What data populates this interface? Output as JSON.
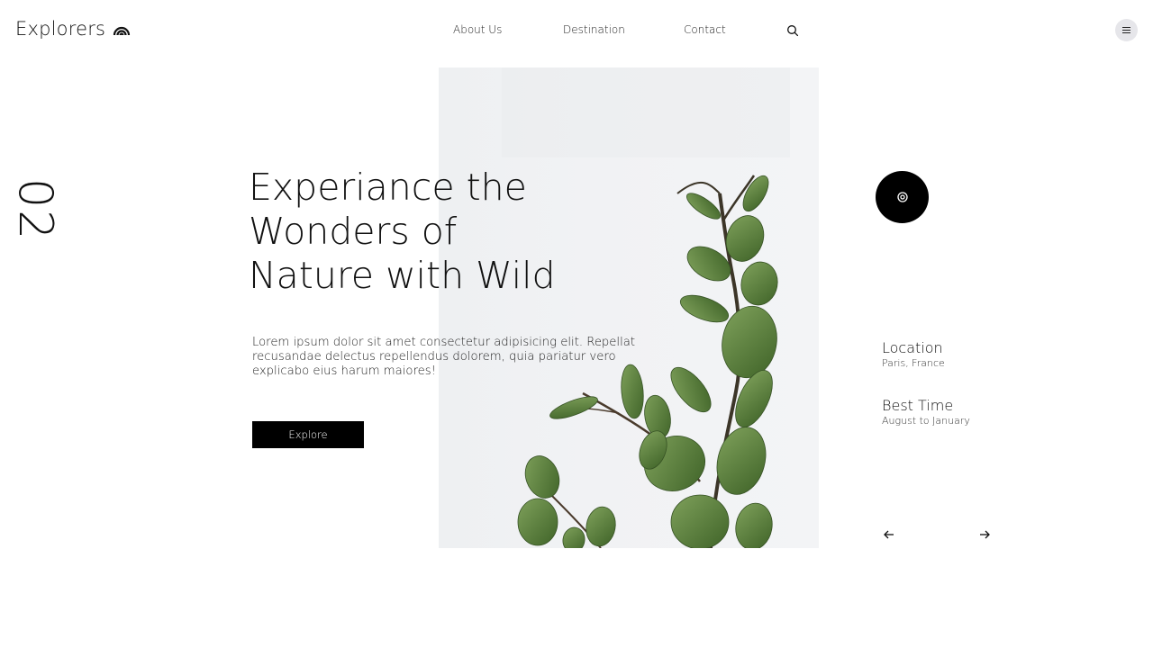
{
  "brand": {
    "name": "Explorers",
    "icon": "rainbow-arc-icon"
  },
  "nav": {
    "items": [
      {
        "label": "About Us"
      },
      {
        "label": "Destination"
      },
      {
        "label": "Contact"
      }
    ],
    "search_icon": "search-icon",
    "menu_icon": "hamburger-menu-icon"
  },
  "slide": {
    "number": "02"
  },
  "hero": {
    "headline_lines": [
      "Experiance the",
      "Wonders of",
      "Nature with Wild"
    ],
    "description": "Lorem ipsum dolor sit amet consectetur adipisicing elit. Repellat recusandae delectus repellendus dolorem, quia pariatur vero explicabo eius harum maiores!",
    "cta_label": "Explore",
    "image": "eucalyptus-branch-photo"
  },
  "view_button": {
    "icon": "eye-icon"
  },
  "details": {
    "location": {
      "label": "Location",
      "value": "Paris, France"
    },
    "best_time": {
      "label": "Best Time",
      "value": "August to January"
    }
  },
  "carousel": {
    "prev_icon": "arrow-left-icon",
    "next_icon": "arrow-right-icon"
  },
  "colors": {
    "accent": "#000000",
    "background": "#ffffff",
    "image_bg": "#f1f2f4",
    "leaf": "#5b7f3e"
  }
}
